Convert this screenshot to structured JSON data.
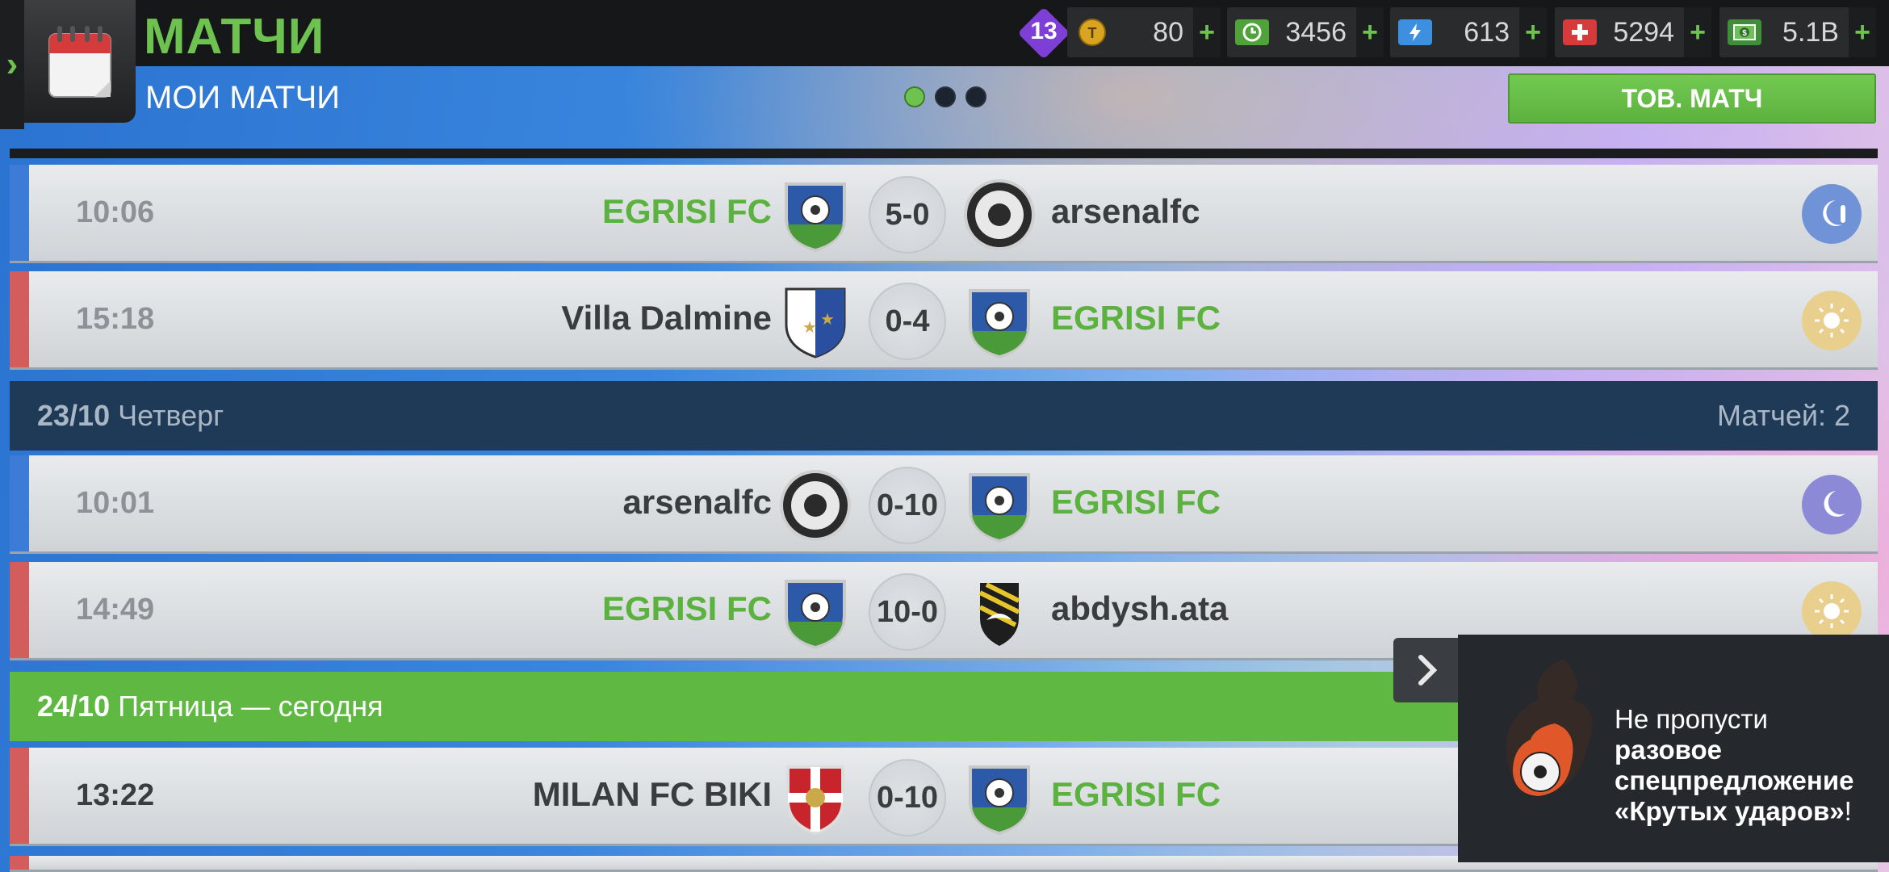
{
  "header": {
    "title": "МАТЧИ",
    "subtitle": "МОИ МАТЧИ",
    "friendly_button": "ТОВ. МАТЧ",
    "level": "13",
    "pages": 3,
    "active_page": 1
  },
  "currencies": [
    {
      "name": "tokens",
      "icon": "token-coin-icon",
      "value": "80",
      "plus": "+"
    },
    {
      "name": "training",
      "icon": "training-clock-icon",
      "value": "3456",
      "plus": "+"
    },
    {
      "name": "energy",
      "icon": "energy-bolt-icon",
      "value": "613",
      "plus": "+"
    },
    {
      "name": "health",
      "icon": "medical-cross-icon",
      "value": "5294",
      "plus": "+"
    },
    {
      "name": "money",
      "icon": "money-bill-icon",
      "value": "5.1B",
      "plus": "+"
    }
  ],
  "matches": [
    {
      "time": "10:06",
      "home": "EGRISI FC",
      "away": "arsenalfc",
      "score": "5-0",
      "weather": "night-cold"
    },
    {
      "time": "15:18",
      "home": "Villa Dalmine",
      "away": "EGRISI FC",
      "score": "0-4",
      "weather": "sunny"
    }
  ],
  "days": [
    {
      "date": "23/10",
      "weekday": "Четверг",
      "count_label": "Матчей: 2",
      "matches": [
        {
          "time": "10:01",
          "home": "arsenalfc",
          "away": "EGRISI FC",
          "score": "0-10",
          "weather": "night"
        },
        {
          "time": "14:49",
          "home": "EGRISI FC",
          "away": "abdysh.ata",
          "score": "10-0",
          "weather": "sunny"
        }
      ]
    },
    {
      "date": "24/10",
      "weekday": "Пятница — сегодня",
      "matches": [
        {
          "time": "13:22",
          "home": "MILAN FC BIKI",
          "away": "EGRISI FC",
          "score": "0-10"
        }
      ]
    }
  ],
  "promo": {
    "text_plain": "Не пропусти ",
    "text_bold": "разовое спецпредложение «Крутых ударов»",
    "text_end": "!"
  },
  "colors": {
    "accent_green": "#6ec24f",
    "home_stripe": "#3c7bd6",
    "away_stripe": "#d35c5c",
    "day_header": "#1e3a57",
    "today_header": "#5eb842"
  }
}
